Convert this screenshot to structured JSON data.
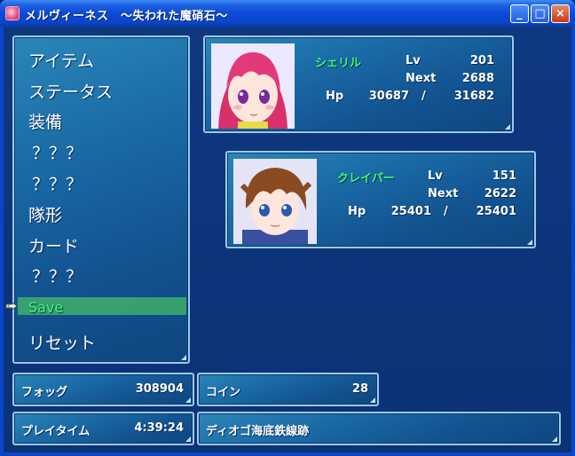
{
  "window": {
    "title": "メルヴィーネス　〜失われた魔硝石〜",
    "minimize": "_",
    "maximize": "□",
    "close": "×"
  },
  "menu": {
    "items": [
      "アイテム",
      "ステータス",
      "装備",
      "？？？",
      "？？？",
      "隊形",
      "カード",
      "？？？",
      "Save",
      "リセット"
    ],
    "selected_index": 8
  },
  "party": [
    {
      "name": "シェリル",
      "lv_label": "Lv",
      "lv": "201",
      "next_label": "Next",
      "next": "2688",
      "hp_label": "Hp",
      "hp": "30687",
      "hp_sep": "/",
      "hp_max": "31682"
    },
    {
      "name": "クレイパー",
      "lv_label": "Lv",
      "lv": "151",
      "next_label": "Next",
      "next": "2622",
      "hp_label": "Hp",
      "hp": "25401",
      "hp_sep": "/",
      "hp_max": "25401"
    }
  ],
  "fog": {
    "label": "フォッグ",
    "value": "308904"
  },
  "coin": {
    "label": "コイン",
    "value": "28"
  },
  "playtime": {
    "label": "プレイタイム",
    "value": "4:39:24"
  },
  "location": {
    "name": "ディオゴ海底鉄線跡"
  },
  "colors": {
    "accent_name": "#3dff6a",
    "selection": "#3fae6c",
    "window_border": "#9cc8e8"
  }
}
